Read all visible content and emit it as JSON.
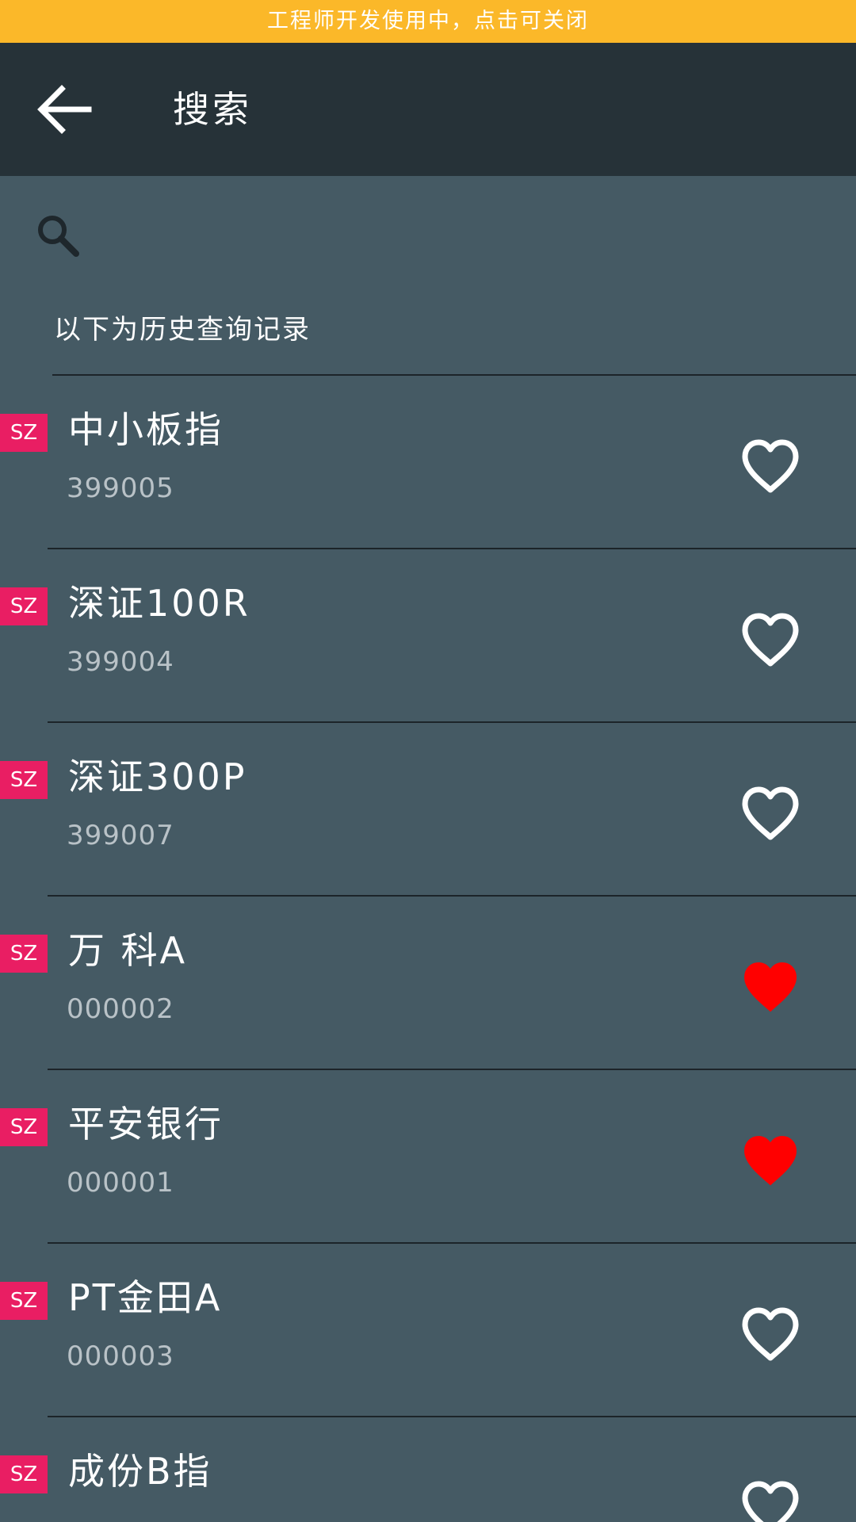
{
  "dev_banner": {
    "text": "工程师开发使用中，点击可关闭",
    "color": "#fbb829"
  },
  "app_bar": {
    "title": "搜索",
    "back_icon": "arrow-back-icon"
  },
  "search": {
    "placeholder": "",
    "value": "",
    "icon": "search-icon"
  },
  "history": {
    "label": "以下为历史查询记录"
  },
  "colors": {
    "badge": "#e91e63",
    "favorite_active": "#ff0000",
    "favorite_inactive": "#ffffff",
    "background": "#455a64",
    "app_bar": "#263238"
  },
  "stocks": [
    {
      "market": "SZ",
      "name": "中小板指",
      "code": "399005",
      "favorite": false
    },
    {
      "market": "SZ",
      "name": "深证100R",
      "code": "399004",
      "favorite": false
    },
    {
      "market": "SZ",
      "name": "深证300P",
      "code": "399007",
      "favorite": false
    },
    {
      "market": "SZ",
      "name": "万 科A",
      "code": "000002",
      "favorite": true
    },
    {
      "market": "SZ",
      "name": "平安银行",
      "code": "000001",
      "favorite": true
    },
    {
      "market": "SZ",
      "name": "PT金田A",
      "code": "000003",
      "favorite": false
    },
    {
      "market": "SZ",
      "name": "成份B指",
      "code": "",
      "favorite": false
    }
  ]
}
